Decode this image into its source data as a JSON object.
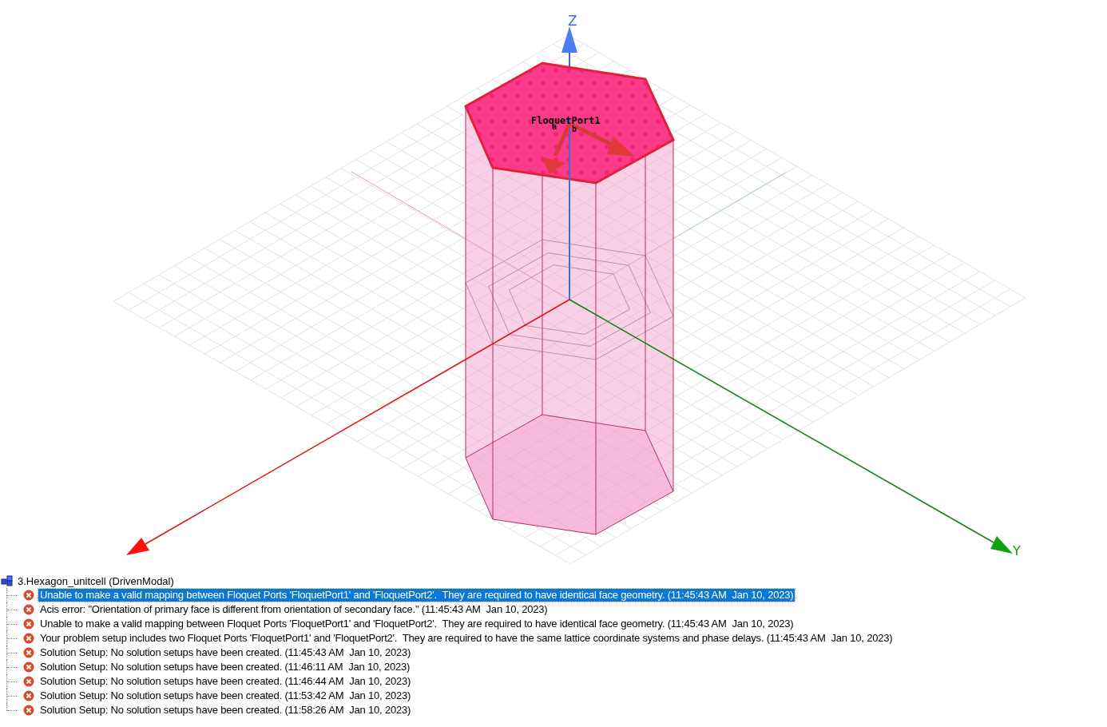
{
  "viewport": {
    "axis_labels": {
      "z": "Z",
      "y": "Y"
    },
    "port_label": "FloquetPort1",
    "vector_labels": [
      "a",
      "b"
    ]
  },
  "message_tree": {
    "label": "3.Hexagon_unitcell (DrivenModal)",
    "children": [
      {
        "kind": "error",
        "text": "Unable to make a valid mapping between Floquet Ports 'FloquetPort1' and 'FloquetPort2'.  They are required to have identical face geometry. (11:45:43 AM  Jan 10, 2023)",
        "selected": true
      },
      {
        "kind": "error",
        "text": "Acis error: \"Orientation of primary face is different from orientation of secondary face.\" (11:45:43 AM  Jan 10, 2023)",
        "selected": false
      },
      {
        "kind": "error",
        "text": "Unable to make a valid mapping between Floquet Ports 'FloquetPort1' and 'FloquetPort2'.  They are required to have identical face geometry. (11:45:43 AM  Jan 10, 2023)",
        "selected": false
      },
      {
        "kind": "error",
        "text": "Your problem setup includes two Floquet Ports 'FloquetPort1' and 'FloquetPort2'.  They are required to have the same lattice coordinate systems and phase delays. (11:45:43 AM  Jan 10, 2023)",
        "selected": false
      },
      {
        "kind": "error",
        "text": "Solution Setup: No solution setups have been created. (11:45:43 AM  Jan 10, 2023)",
        "selected": false
      },
      {
        "kind": "error",
        "text": "Solution Setup: No solution setups have been created. (11:46:11 AM  Jan 10, 2023)",
        "selected": false
      },
      {
        "kind": "error",
        "text": "Solution Setup: No solution setups have been created. (11:46:44 AM  Jan 10, 2023)",
        "selected": false
      },
      {
        "kind": "error",
        "text": "Solution Setup: No solution setups have been created. (11:53:42 AM  Jan 10, 2023)",
        "selected": false
      },
      {
        "kind": "error",
        "text": "Solution Setup: No solution setups have been created. (11:58:26 AM  Jan 10, 2023)",
        "selected": false
      }
    ]
  }
}
